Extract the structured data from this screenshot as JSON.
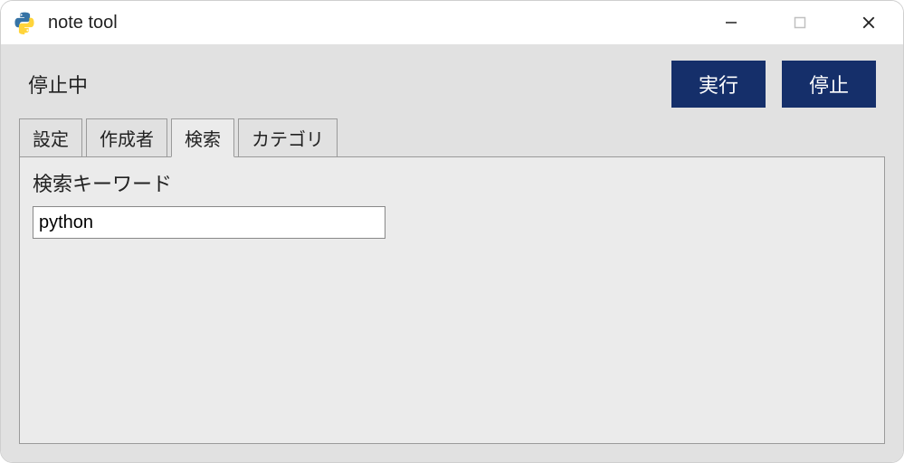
{
  "window": {
    "title": "note tool"
  },
  "topbar": {
    "status": "停止中",
    "run_label": "実行",
    "stop_label": "停止"
  },
  "tabs": {
    "items": [
      {
        "label": "設定"
      },
      {
        "label": "作成者"
      },
      {
        "label": "検索"
      },
      {
        "label": "カテゴリ"
      }
    ],
    "active_index": 2
  },
  "search_panel": {
    "keyword_label": "検索キーワード",
    "keyword_value": "python"
  },
  "colors": {
    "button_bg": "#152f6a",
    "client_bg": "#e1e1e1",
    "panel_bg": "#ebebeb"
  }
}
